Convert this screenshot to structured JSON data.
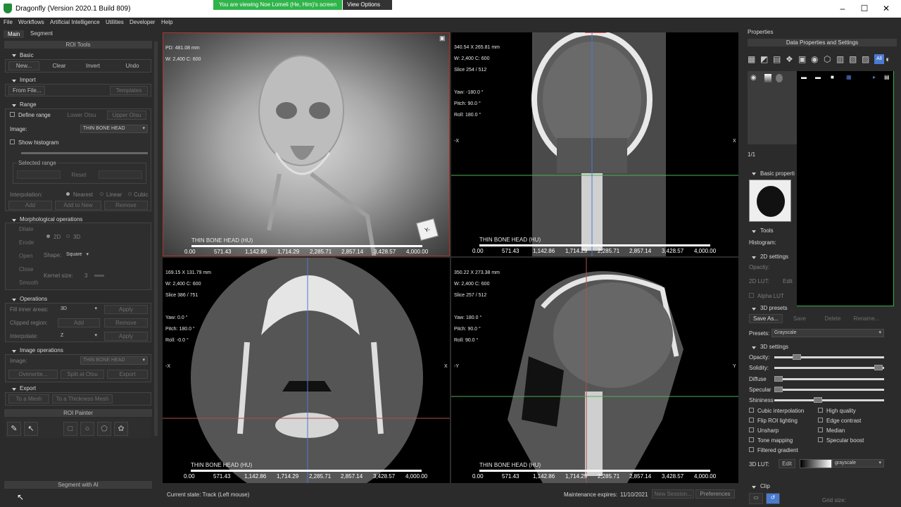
{
  "window": {
    "title": "Dragonfly (Version 2020.1 Build 809)",
    "share_banner": "You are viewing Noe Lomeli (He, Him)'s screen",
    "view_options": "View Options"
  },
  "menu": [
    "File",
    "Workflows",
    "Artificial Intelligence",
    "Utilities",
    "Developer",
    "Help"
  ],
  "left": {
    "tabs": [
      "Main",
      "Segment"
    ],
    "roi_tools": "ROI Tools",
    "basic": {
      "title": "Basic",
      "buttons": [
        "New...",
        "Clear",
        "Invert",
        "Undo"
      ]
    },
    "import": {
      "title": "Import",
      "from_file": "From File...",
      "templates": "Templates"
    },
    "range": {
      "title": "Range",
      "define_range": "Define range",
      "lower_otsu": "Lower Otsu",
      "upper_otsu": "Upper Otsu",
      "image_label": "Image:",
      "image_value": "THIN BONE HEAD",
      "show_histogram": "Show histogram",
      "selected_range": "Selected range",
      "reset": "Reset",
      "interpolation": "Interpolation:",
      "nearest": "Nearest",
      "linear": "Linear",
      "cubic": "Cubic",
      "add": "Add",
      "add_to_new": "Add to New",
      "remove": "Remove"
    },
    "morph": {
      "title": "Morphological operations",
      "dilate": "Dilate",
      "erode": "Erode",
      "open": "Open",
      "close": "Close",
      "smooth": "Smooth",
      "two_d": "2D",
      "three_d": "3D",
      "shape_label": "Shape:",
      "shape_value": "Square",
      "kernel_label": "Kernel size:",
      "kernel_value": "3"
    },
    "operations": {
      "title": "Operations",
      "fill_label": "Fill inner areas:",
      "fill_value": "3D",
      "apply": "Apply",
      "clipped_label": "Clipped region:",
      "add": "Add",
      "remove": "Remove",
      "interp_label": "Interpolate:",
      "interp_value": "Z"
    },
    "image_ops": {
      "title": "Image operations",
      "image_label": "Image:",
      "image_value": "THIN BONE HEAD",
      "overwrite": "Overwrite...",
      "split": "Split at Otsu",
      "export": "Export"
    },
    "export": {
      "title": "Export",
      "to_mesh": "To a Mesh",
      "to_thickness": "To a Thickness Mesh"
    },
    "roi_painter": "ROI Painter",
    "segment_ai": "Segment with AI"
  },
  "viewports": {
    "v3d": {
      "pd": "PD: 481.08 mm",
      "wc": "W: 2,400 C: 600",
      "label": "THIN BONE HEAD (HU)",
      "cube": "Y-"
    },
    "coronal": {
      "size": "340.54 X 265.81 mm",
      "wc": "W: 2,400 C: 600",
      "slice": "Slice 254 / 512",
      "yaw": "Yaw: -180.0 °",
      "pitch": "Pitch: 90.0 °",
      "roll": "Roll: 180.0 °",
      "left": "-X",
      "right": "X",
      "label": "THIN BONE HEAD (HU)"
    },
    "axial": {
      "size": "169.15 X 131.79 mm",
      "wc": "W: 2,400 C: 600",
      "slice": "Slice 386 / 751",
      "yaw": "Yaw: 0.0 °",
      "pitch": "Pitch: 180.0 °",
      "roll": "Roll: -0.0 °",
      "left": "-X",
      "right": "X",
      "label": "THIN BONE HEAD (HU)"
    },
    "sagittal": {
      "size": "350.22 X 273.38 mm",
      "wc": "W: 2,400 C: 600",
      "slice": "Slice 257 / 512",
      "yaw": "Yaw: 180.0 °",
      "pitch": "Pitch: 90.0 °",
      "roll": "Roll: 90.0 °",
      "left": "-Y",
      "right": "Y",
      "label": "THIN BONE HEAD (HU)"
    },
    "ticks": [
      "0.00",
      "571.43",
      "1,142.86",
      "1,714.29",
      "2,285.71",
      "2,857.14",
      "3,428.57",
      "4,000.00"
    ]
  },
  "right": {
    "properties": "Properties",
    "data_props": "Data Properties and Settings",
    "page_count": "1/1",
    "basic_props": "Basic properti",
    "tools": "Tools",
    "histogram": "Histogram:",
    "settings_2d": "2D settings",
    "opacity": "Opacity:",
    "lut_2d": "2D LUT:",
    "edit": "Edit",
    "alpha_lut": "Alpha LUT",
    "presets_3d": "3D presets",
    "save_as": "Save As...",
    "save": "Save",
    "delete": "Delete",
    "rename": "Rename...",
    "presets_label": "Presets:",
    "presets_value": "Grayscale",
    "settings_3d": "3D settings",
    "sliders": [
      "Opacity:",
      "Solidity:",
      "Diffuse",
      "Specular",
      "Shininess"
    ],
    "checks_left": [
      "Cubic interpolation",
      "Flip ROI lighting",
      "Unsharp",
      "Tone mapping",
      "Filtered gradient"
    ],
    "checks_right": [
      "High quality",
      "Edge contrast",
      "Median",
      "Specular boost"
    ],
    "lut_3d": "3D LUT:",
    "lut_value": "grayscale",
    "clip": "Clip",
    "grid_size": "Grid size:"
  },
  "status": {
    "state": "Current state: Track (Left mouse)",
    "maintenance": "Maintenance expires:",
    "date": "11/10/2021",
    "new_session": "New Session...",
    "preferences": "Preferences"
  }
}
